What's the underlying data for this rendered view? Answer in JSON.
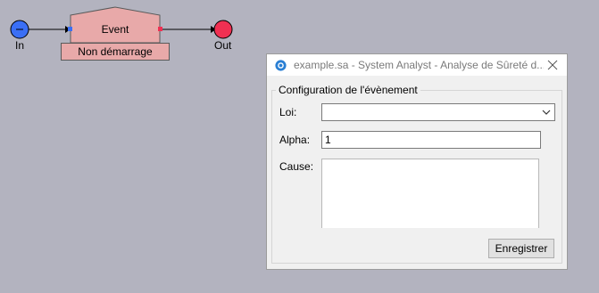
{
  "diagram": {
    "input_node": {
      "label": "In",
      "color": "#3b6ff5"
    },
    "output_node": {
      "label": "Out",
      "color": "#f03052"
    },
    "event": {
      "name": "Event",
      "status": "Non démarrage",
      "fill": "#e8a9a9"
    }
  },
  "dialog": {
    "title": "example.sa - System Analyst - Analyse de Sûreté d...",
    "group_title": "Configuration de l'évènement",
    "fields": {
      "loi": {
        "label": "Loi:",
        "value": ""
      },
      "alpha": {
        "label": "Alpha:",
        "value": "1"
      },
      "cause": {
        "label": "Cause:",
        "value": ""
      }
    },
    "save_label": "Enregistrer"
  }
}
